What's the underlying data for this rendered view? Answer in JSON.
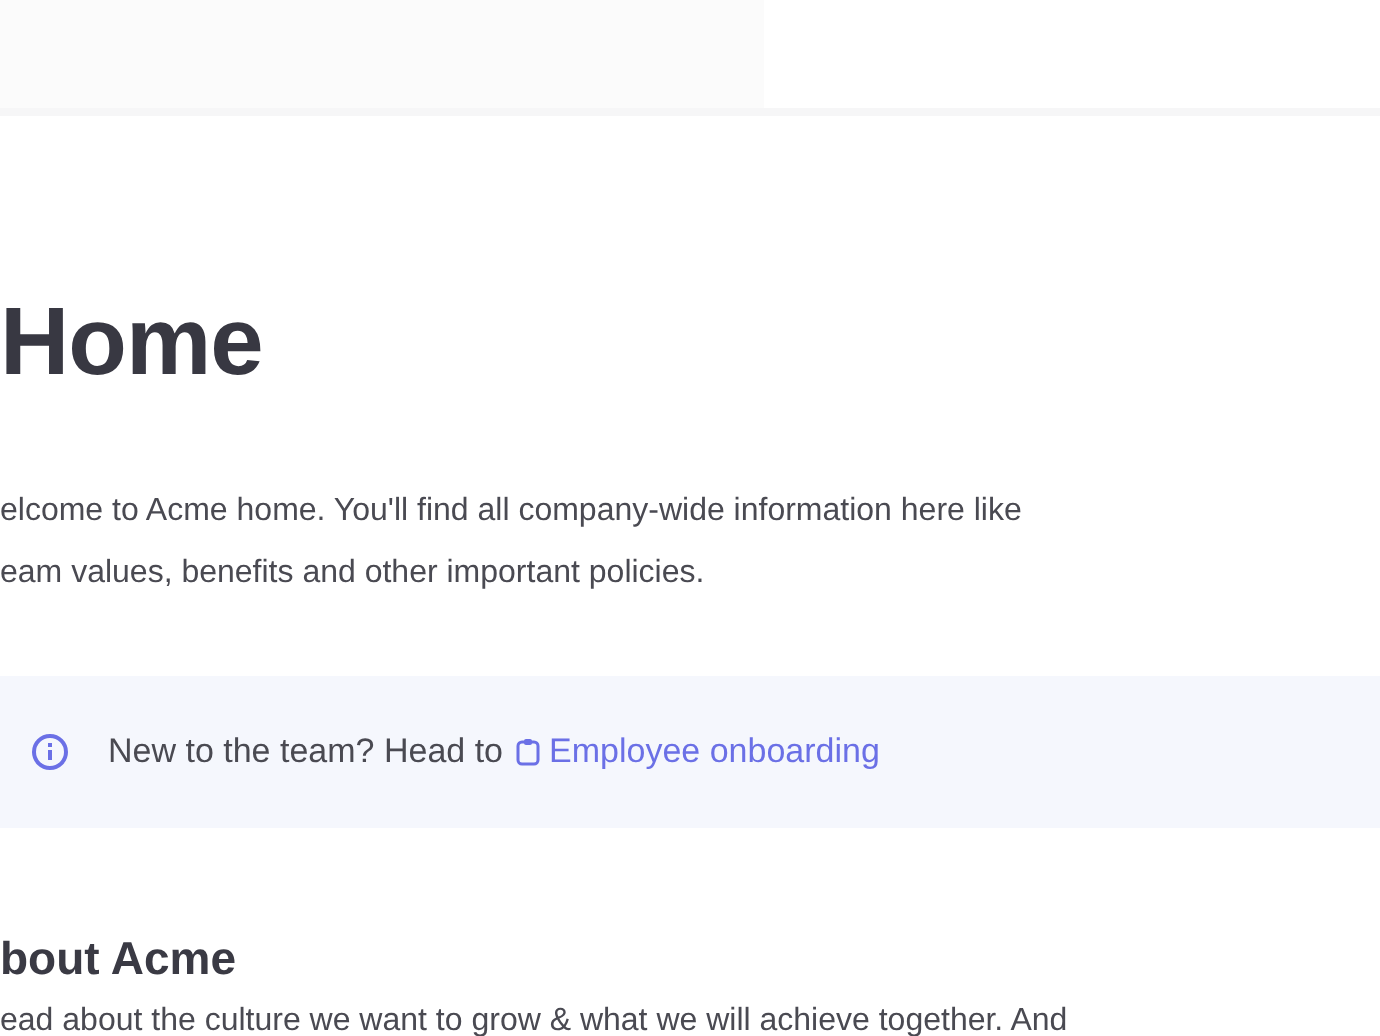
{
  "page": {
    "title": "Home",
    "intro_lines": [
      "elcome to Acme home. You'll find all company-wide information here like",
      "eam values, benefits and other important policies."
    ],
    "callout": {
      "text": "New to the team? Head to",
      "link": "Employee onboarding"
    },
    "section": {
      "heading": "bout Acme",
      "text": "ead about the culture we want to grow & what we will achieve together. And"
    }
  }
}
